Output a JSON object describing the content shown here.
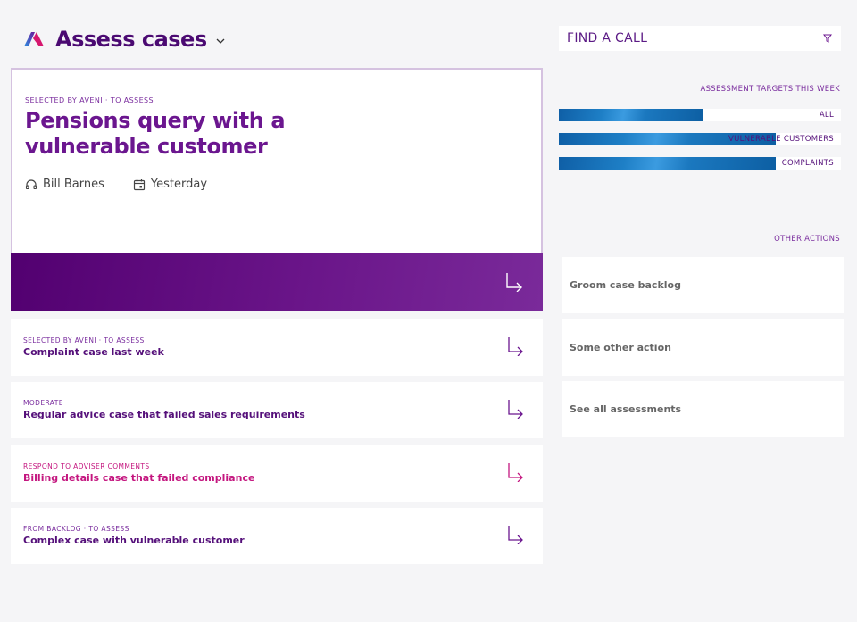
{
  "header": {
    "title": "Assess cases"
  },
  "search": {
    "placeholder": "FIND A CALL"
  },
  "featured": {
    "kicker": "SELECTED BY AVENI · TO ASSESS",
    "title": "Pensions query with a vulnerable customer",
    "agent": "Bill Barnes",
    "date": "Yesterday"
  },
  "cases": [
    {
      "kicker": "SELECTED BY AVENI · TO ASSESS",
      "title": "Complaint case last week"
    },
    {
      "kicker": "MODERATE",
      "title": "Regular advice case that failed sales requirements"
    },
    {
      "kicker": "RESPOND TO ADVISER COMMENTS",
      "title": "Billing details case that failed compliance"
    },
    {
      "kicker": "FROM BACKLOG · TO ASSESS",
      "title": "Complex case with vulnerable customer"
    }
  ],
  "targets": {
    "heading": "ASSESSMENT TARGETS THIS WEEK",
    "items": [
      {
        "label": "ALL",
        "progress": 0.51
      },
      {
        "label": "VULNERABLE CUSTOMERS",
        "progress": 0.77
      },
      {
        "label": "COMPLAINTS",
        "progress": 0.77
      }
    ]
  },
  "other_actions": {
    "heading": "OTHER ACTIONS",
    "items": [
      "Groom case backlog",
      "Some other action",
      "See all assessments"
    ]
  },
  "colors": {
    "brand_purple": "#4b0a72",
    "accent_pink": "#c4167f",
    "target_blue": "#1b78bf"
  }
}
